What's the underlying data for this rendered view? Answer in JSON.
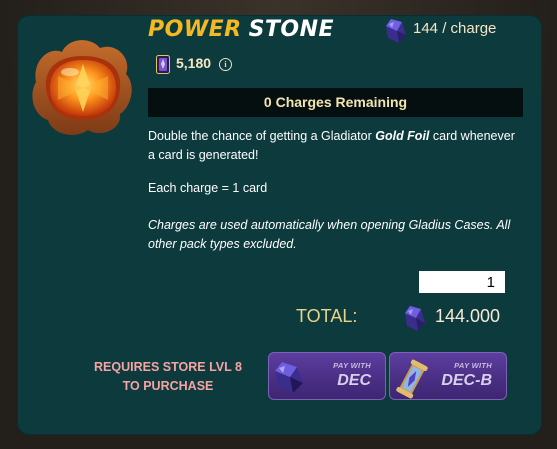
{
  "item": {
    "title_word1": "POWER",
    "title_word2": "STONE",
    "price_per_charge": "144 / charge",
    "owned_count": "5,180",
    "info_icon": "i",
    "charges_remaining": "0 Charges Remaining",
    "description_before": "Double the chance of getting a Gladiator ",
    "description_emphasis": "Gold Foil",
    "description_after": " card whenever a card is generated!",
    "charge_rule": "Each charge = 1 card",
    "note": "Charges are used automatically when opening Gladius Cases. All other pack types excluded."
  },
  "purchase": {
    "quantity": "1",
    "total_label": "TOTAL:",
    "total_value": "144.000",
    "requirement": "REQUIRES STORE LVL 8 TO PURCHASE",
    "buttons": [
      {
        "pay_label": "PAY WITH",
        "currency": "DEC",
        "icon": "dec-crystal-icon"
      },
      {
        "pay_label": "PAY WITH",
        "currency": "DEC-B",
        "icon": "dec-b-scroll-icon"
      }
    ]
  },
  "colors": {
    "panel": "#0d3a3d",
    "title_gold": "#f4b921",
    "charges_bar": "#060f10",
    "button_purple": "#4a2f85",
    "requirement_pink": "#f5a3a3"
  }
}
